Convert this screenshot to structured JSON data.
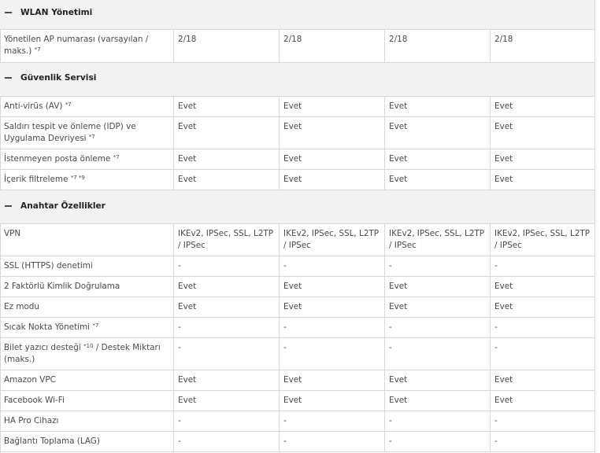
{
  "sections": {
    "wlan": {
      "title": "WLAN Yönetimi"
    },
    "security": {
      "title": "Güvenlik Servisi"
    },
    "features": {
      "title": "Anahtar Özellikler"
    }
  },
  "rows": {
    "ap": {
      "label": "Yönetilen AP numarası (varsayılan / maks.)",
      "sup": "*7",
      "values": [
        "2/18",
        "2/18",
        "2/18",
        "2/18"
      ]
    },
    "av": {
      "label": "Anti-virüs (AV)",
      "sup": "*7",
      "values": [
        "Evet",
        "Evet",
        "Evet",
        "Evet"
      ]
    },
    "idp": {
      "label": "Saldırı tespit ve önleme (IDP) ve Uygulama Devriyesi",
      "sup": "*7",
      "values": [
        "Evet",
        "Evet",
        "Evet",
        "Evet"
      ]
    },
    "spam": {
      "label": "İstenmeyen posta önleme",
      "sup": "*7",
      "values": [
        "Evet",
        "Evet",
        "Evet",
        "Evet"
      ]
    },
    "content": {
      "label": "İçerik filtreleme",
      "sup": "*7 *9",
      "values": [
        "Evet",
        "Evet",
        "Evet",
        "Evet"
      ]
    },
    "vpn": {
      "label": "VPN",
      "sup": "",
      "values": [
        "IKEv2, IPSec, SSL, L2TP / IPSec",
        "IKEv2, IPSec, SSL, L2TP / IPSec",
        "IKEv2, IPSec, SSL, L2TP / IPSec",
        "IKEv2, IPSec, SSL, L2TP / IPSec"
      ]
    },
    "ssl": {
      "label": "SSL (HTTPS) denetimi",
      "sup": "",
      "values": [
        "-",
        "-",
        "-",
        "-"
      ]
    },
    "twofa": {
      "label": "2 Faktörlü Kimlik Doğrulama",
      "sup": "",
      "values": [
        "Evet",
        "Evet",
        "Evet",
        "Evet"
      ]
    },
    "ez": {
      "label": "Ez modu",
      "sup": "",
      "values": [
        "Evet",
        "Evet",
        "Evet",
        "Evet"
      ]
    },
    "hotspot": {
      "label": "Sıcak Nokta Yönetimi",
      "sup": "*7",
      "values": [
        "-",
        "-",
        "-",
        "-"
      ]
    },
    "ticket": {
      "label_a": "Bilet yazıcı desteği",
      "sup": "*10",
      "label_b": "/ Destek Miktarı (maks.)",
      "values": [
        "-",
        "-",
        "-",
        "-"
      ]
    },
    "amazon": {
      "label": "Amazon VPC",
      "sup": "",
      "values": [
        "Evet",
        "Evet",
        "Evet",
        "Evet"
      ]
    },
    "facebook": {
      "label": "Facebook Wi-Fi",
      "sup": "",
      "values": [
        "Evet",
        "Evet",
        "Evet",
        "Evet"
      ]
    },
    "hapro": {
      "label": "HA Pro Cihazı",
      "sup": "",
      "values": [
        "-",
        "-",
        "-",
        "-"
      ]
    },
    "lag": {
      "label": "Bağlantı Toplama (LAG)",
      "sup": "",
      "values": [
        "-",
        "-",
        "-",
        "-"
      ]
    }
  }
}
